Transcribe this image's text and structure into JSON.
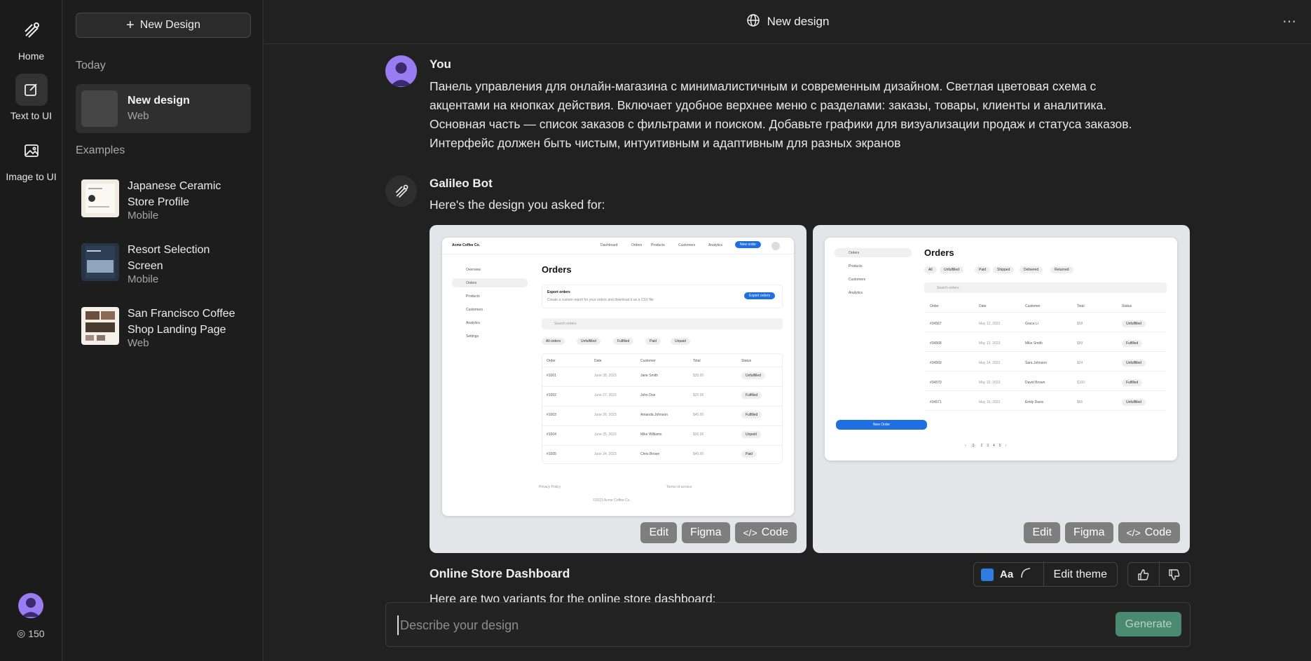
{
  "rail": {
    "items": [
      {
        "label": "Home"
      },
      {
        "label": "Text to UI"
      },
      {
        "label": "Image to UI"
      }
    ],
    "credits": "150"
  },
  "sidebar": {
    "new_button": "New Design",
    "today_label": "Today",
    "history": [
      {
        "title": "New design",
        "type": "Web"
      }
    ],
    "examples_label": "Examples",
    "examples": [
      {
        "title": "Japanese Ceramic Store Profile",
        "type": "Mobile"
      },
      {
        "title": "Resort Selection Screen",
        "type": "Mobile"
      },
      {
        "title": "San Francisco Coffee Shop Landing Page",
        "type": "Web"
      }
    ]
  },
  "header": {
    "title": "New design",
    "menu": "⋯"
  },
  "chat": {
    "user_name": "You",
    "user_message": "Панель управления для онлайн-магазина с минималистичным и современным дизайном. Светлая цветовая схема с акцентами на кнопках действия. Включает удобное верхнее меню с разделами: заказы, товары, клиенты и аналитика. Основная часть — список заказов с фильтрами и поиском. Добавьте графики для визуализации продаж и статуса заказов. Интерфейс должен быть чистым, интуитивным и адаптивным для разных экранов",
    "bot_name": "Galileo Bot",
    "bot_message": "Here's the design you asked for:",
    "card_buttons": {
      "edit": "Edit",
      "figma": "Figma",
      "code": "Code"
    },
    "result_title": "Online Store Dashboard",
    "result_sub": "Here are two variants for the online store dashboard:",
    "theme": {
      "aa": "Aa",
      "edit": "Edit theme",
      "accent": "#2f7de1"
    }
  },
  "variant1": {
    "brand": "Acme Coffee Co.",
    "nav": [
      "Dashboard",
      "Orders",
      "Products",
      "Customers",
      "Analytics"
    ],
    "new_order": "New order",
    "side": [
      "Overview",
      "Orders",
      "Products",
      "Customers",
      "Analytics",
      "Settings"
    ],
    "heading": "Orders",
    "export_title": "Export orders",
    "export_desc": "Create a custom report for your orders and download it as a CSV file",
    "export_btn": "Export orders",
    "search": "Search orders",
    "filters": [
      "All orders",
      "Unfulfilled",
      "Fulfilled",
      "Paid",
      "Unpaid"
    ],
    "cols": [
      "Order",
      "Date",
      "Customer",
      "Total",
      "Status"
    ],
    "rows": [
      [
        "#1001",
        "June 28, 2023",
        "Jane Smith",
        "$35.00",
        "Unfulfilled"
      ],
      [
        "#1002",
        "June 27, 2023",
        "John Doe",
        "$25.00",
        "Fulfilled"
      ],
      [
        "#1003",
        "June 26, 2023",
        "Amanda Johnson",
        "$45.00",
        "Fulfilled"
      ],
      [
        "#1004",
        "June 25, 2023",
        "Mike Williams",
        "$30.00",
        "Unpaid"
      ],
      [
        "#1005",
        "June 24, 2023",
        "Chris Brown",
        "$40.00",
        "Paid"
      ]
    ],
    "footer_left": "Privacy Policy",
    "footer_right": "Terms of service",
    "copyright": "©2023 Acme Coffee Co."
  },
  "variant2": {
    "side": [
      "Orders",
      "Products",
      "Customers",
      "Analytics"
    ],
    "new_order": "New Order",
    "heading": "Orders",
    "tabs": [
      "All",
      "Unfulfilled",
      "Paid",
      "Shipped",
      "Delivered",
      "Returned"
    ],
    "search": "Search orders",
    "cols": [
      "Order",
      "Date",
      "Customer",
      "Total",
      "Status"
    ],
    "rows": [
      [
        "#34567",
        "May 12, 2023",
        "Grace Li",
        "$58",
        "Unfulfilled"
      ],
      [
        "#34568",
        "May 13, 2023",
        "Mike Smith",
        "$89",
        "Fulfilled"
      ],
      [
        "#34569",
        "May 14, 2023",
        "Sara Johnson",
        "$24",
        "Unfulfilled"
      ],
      [
        "#34570",
        "May 15, 2023",
        "David Brown",
        "$100",
        "Fulfilled"
      ],
      [
        "#34571",
        "May 16, 2023",
        "Emily Davis",
        "$65",
        "Unfulfilled"
      ]
    ],
    "pages": [
      "‹",
      "1",
      "2",
      "3",
      "4",
      "5",
      "›"
    ]
  },
  "composer": {
    "placeholder": "Describe your design",
    "generate": "Generate"
  }
}
